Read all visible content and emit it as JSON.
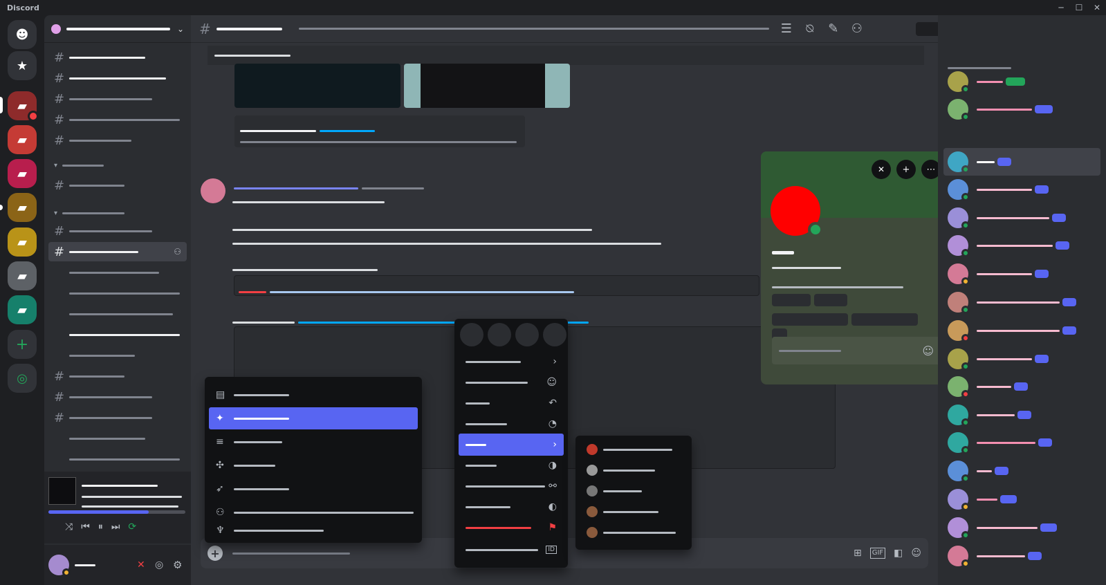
{
  "app": {
    "title": "Discord"
  },
  "window": {
    "minimize": "─",
    "maximize": "☐",
    "close": "✕"
  },
  "colors": {
    "accent": "#5865f2",
    "online": "#23a55a",
    "dnd": "#f23f43",
    "idle": "#f0b232",
    "profile_bg": "#3f4a3a"
  },
  "guilds": [
    {
      "icon": "discord-logo",
      "glyph": "☻",
      "color": "#5865f2"
    },
    {
      "icon": "star-icon",
      "glyph": "★",
      "color": "#313338"
    },
    {
      "icon": "folder-icon",
      "glyph": "▰",
      "color": "#8e2b2b"
    },
    {
      "icon": "folder-icon",
      "glyph": "▰",
      "color": "#c53b35"
    },
    {
      "icon": "folder-icon",
      "glyph": "▰",
      "color": "#b81e4d"
    },
    {
      "icon": "folder-icon",
      "glyph": "▰",
      "color": "#8b6417"
    },
    {
      "icon": "folder-icon",
      "glyph": "▰",
      "color": "#b99318"
    },
    {
      "icon": "folder-icon",
      "glyph": "▰",
      "color": "#5d6166"
    },
    {
      "icon": "folder-icon",
      "glyph": "▰",
      "color": "#16806b"
    },
    {
      "icon": "add-server-icon",
      "glyph": "+",
      "color": "#313338"
    },
    {
      "icon": "explore-icon",
      "glyph": "◎",
      "color": "#313338"
    }
  ],
  "channels": {
    "symbols": [
      "#",
      "#",
      "#",
      "#",
      "#",
      "#",
      "#",
      "#",
      "#",
      "#",
      "#",
      "#",
      "#",
      "#",
      "#",
      "#",
      "#",
      "#",
      "#",
      "#"
    ],
    "headers": [
      "▾",
      "▾"
    ]
  },
  "topbar": {
    "hash": "#"
  },
  "player": {
    "controls": [
      "⤨",
      "⏮",
      "⏸",
      "⏭",
      "⟳"
    ],
    "progress": 0.73
  },
  "composer": {
    "plus": "+",
    "gif": "GIF"
  },
  "context_menu": {
    "arrow": "›",
    "flag": "⚑",
    "id": "ID"
  },
  "profile_actions": [
    "✕",
    "+",
    "⋯"
  ]
}
